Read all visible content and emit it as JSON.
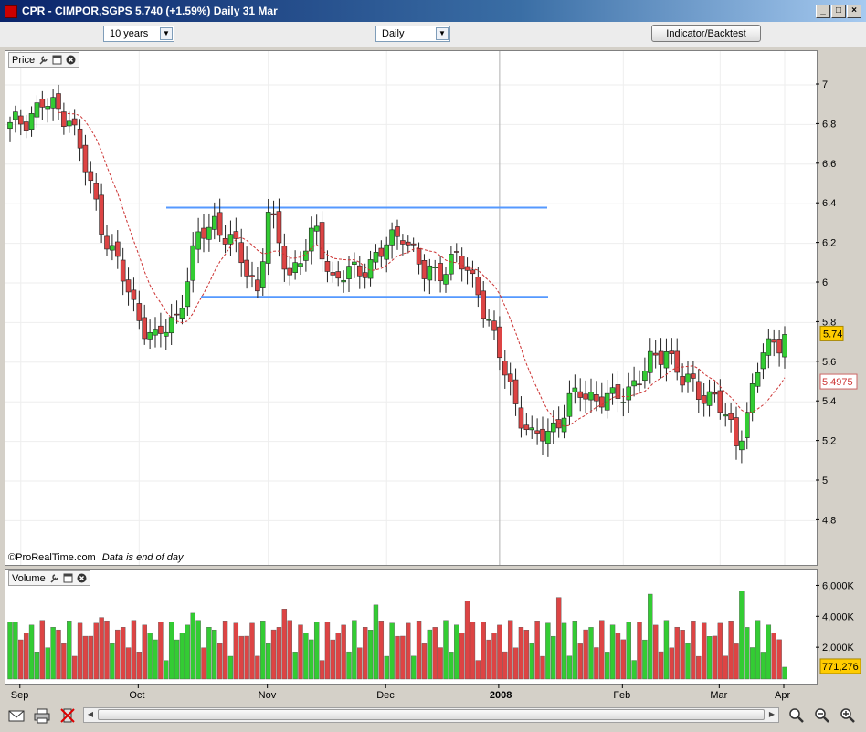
{
  "window": {
    "title": "CPR - CIMPOR,SGPS   5.740 (+1.59%)   Daily  31 Mar",
    "minimize_label": "_",
    "maximize_label": "□",
    "close_label": "×"
  },
  "toolbar": {
    "period_value": "10 years",
    "interval_value": "Daily",
    "indicator_button": "Indicator/Backtest"
  },
  "price_panel": {
    "label": "Price",
    "watermark": "©ProRealTime.com",
    "note": "Data is end of day",
    "last_price_tag": "5.74",
    "ma_tag": "5.4975",
    "y_ticks": [
      "7",
      "6.8",
      "6.6",
      "6.4",
      "6.2",
      "6",
      "5.8",
      "5.6",
      "5.4",
      "5.2",
      "5",
      "4.8"
    ]
  },
  "volume_panel": {
    "label": "Volume",
    "last_volume_tag": "771,276",
    "y_ticks": [
      "6,000K",
      "4,000K",
      "2,000K"
    ]
  },
  "x_axis": {
    "labels": [
      "Sep",
      "Oct",
      "Nov",
      "Dec",
      "2008",
      "Feb",
      "Mar",
      "Apr"
    ]
  },
  "colors": {
    "up": "#33cc33",
    "down": "#dd4444",
    "channel": "#5599ff",
    "ma": "#cc3333",
    "price_tag": "#ffcc00"
  },
  "chart_data": {
    "type": "candlestick",
    "title": "CPR - CIMPOR,SGPS",
    "x_range": [
      "2007-08-27",
      "2008-03-31"
    ],
    "ylim": [
      4.7,
      7.15
    ],
    "moving_average_last": 5.4975,
    "channel_lines": [
      6.38,
      5.93
    ],
    "last_close": 5.74,
    "last_volume": 771276,
    "anchors": [
      {
        "day": 0,
        "close": 6.78
      },
      {
        "day": 6,
        "close": 6.9
      },
      {
        "day": 11,
        "close": 6.85
      },
      {
        "day": 17,
        "close": 6.3
      },
      {
        "day": 23,
        "close": 5.88
      },
      {
        "day": 27,
        "close": 5.7
      },
      {
        "day": 31,
        "close": 5.84
      },
      {
        "day": 35,
        "close": 6.22
      },
      {
        "day": 38,
        "close": 6.32
      },
      {
        "day": 43,
        "close": 6.12
      },
      {
        "day": 46,
        "close": 5.97
      },
      {
        "day": 48,
        "close": 6.34
      },
      {
        "day": 52,
        "close": 6.05
      },
      {
        "day": 57,
        "close": 6.25
      },
      {
        "day": 60,
        "close": 6.02
      },
      {
        "day": 64,
        "close": 6.05
      },
      {
        "day": 69,
        "close": 6.15
      },
      {
        "day": 73,
        "close": 6.27
      },
      {
        "day": 77,
        "close": 6.03
      },
      {
        "day": 83,
        "close": 6.12
      },
      {
        "day": 87,
        "close": 5.98
      },
      {
        "day": 90,
        "close": 5.7
      },
      {
        "day": 94,
        "close": 5.4
      },
      {
        "day": 97,
        "close": 5.2
      },
      {
        "day": 100,
        "close": 5.25
      },
      {
        "day": 106,
        "close": 5.45
      },
      {
        "day": 112,
        "close": 5.4
      },
      {
        "day": 118,
        "close": 5.55
      },
      {
        "day": 122,
        "close": 5.68
      },
      {
        "day": 125,
        "close": 5.5
      },
      {
        "day": 131,
        "close": 5.42
      },
      {
        "day": 135,
        "close": 5.2
      },
      {
        "day": 137,
        "close": 5.35
      },
      {
        "day": 140,
        "close": 5.65
      },
      {
        "day": 144,
        "close": 5.74
      }
    ]
  }
}
